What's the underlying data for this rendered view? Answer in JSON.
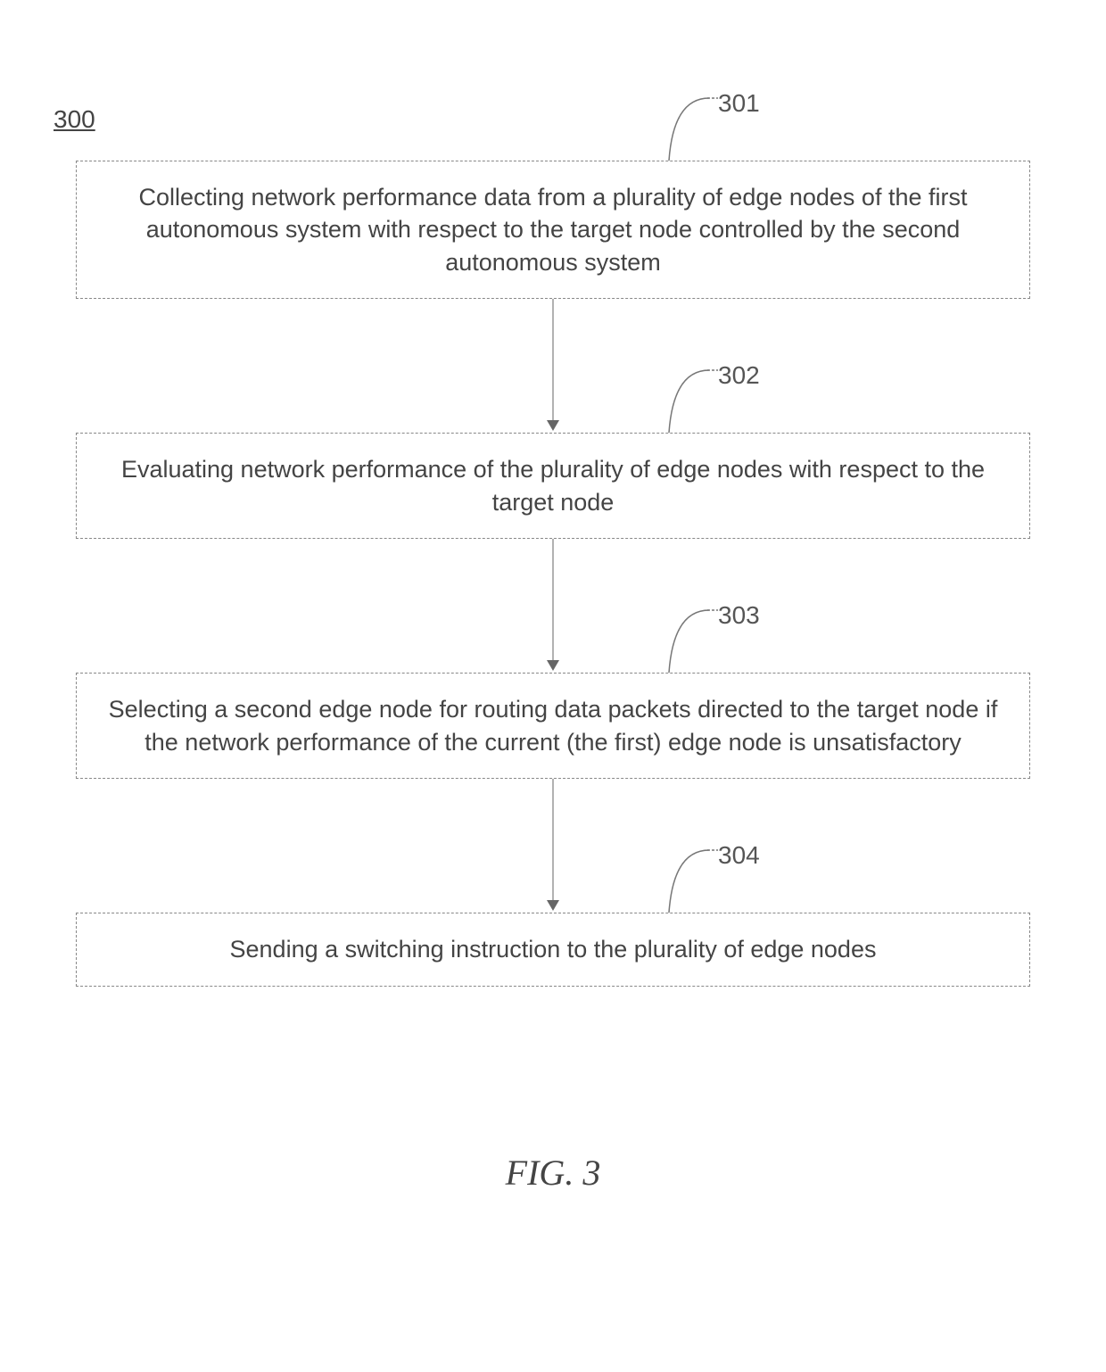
{
  "diagram_label": "300",
  "steps": [
    {
      "num": "301",
      "text": "Collecting network performance data from a plurality of edge nodes of the first autonomous system with respect to the target node controlled by the second autonomous system"
    },
    {
      "num": "302",
      "text": "Evaluating network performance of the plurality of edge nodes with respect to the target node"
    },
    {
      "num": "303",
      "text": "Selecting a second edge node for routing data packets directed to the target node if the network performance of the current (the first) edge node is unsatisfactory"
    },
    {
      "num": "304",
      "text": "Sending a switching instruction to the plurality of edge nodes"
    }
  ],
  "caption": "FIG. 3"
}
